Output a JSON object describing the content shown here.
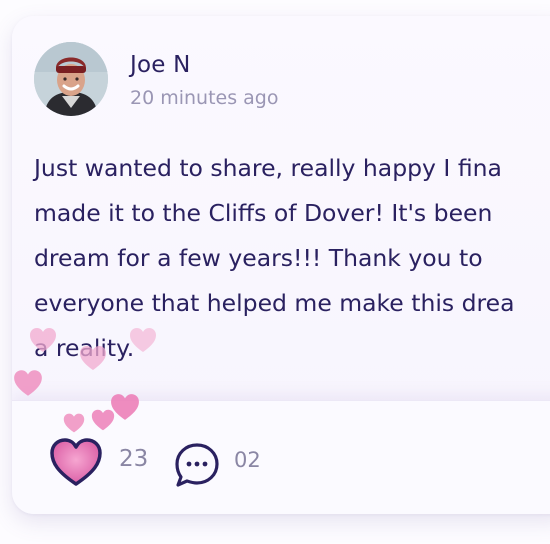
{
  "post": {
    "author": "Joe N",
    "timestamp": "20 minutes ago",
    "body_lines": [
      "Just wanted to share, really happy I fina",
      "made it to the Cliffs of Dover! It's been",
      "dream for a few years!!! Thank you to",
      "everyone that helped me make this drea",
      "a reality."
    ]
  },
  "actions": {
    "like_icon": "heart-icon",
    "like_count": "23",
    "comment_icon": "speech-bubble-icon",
    "comment_count": "02"
  },
  "colors": {
    "text": "#2a2160",
    "muted": "#9a96b4",
    "heart_pink": "#e87ab6",
    "icon_stroke": "#2a2160"
  }
}
